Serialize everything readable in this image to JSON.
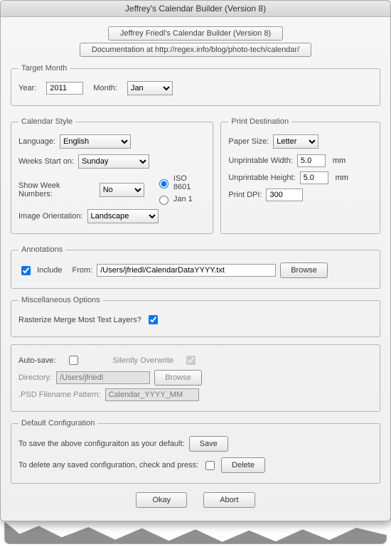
{
  "window": {
    "title": "Jeffrey's Calendar Builder (Version 8)"
  },
  "header": {
    "app_title": "Jeffrey Friedl's Calendar Builder (Version 8)",
    "doc_line": "Documentation at http://regex.info/blog/photo-tech/calendar/"
  },
  "target_month": {
    "legend": "Target Month",
    "year_label": "Year:",
    "year_value": "2011",
    "month_label": "Month:",
    "month_value": "Jan"
  },
  "calendar_style": {
    "legend": "Calendar Style",
    "language_label": "Language:",
    "language_value": "English",
    "weeks_start_label": "Weeks Start on:",
    "weeks_start_value": "Sunday",
    "show_week_label": "Show Week Numbers:",
    "show_week_value": "No",
    "radio_iso": "ISO 8601",
    "radio_jan1": "Jan 1",
    "orientation_label": "Image Orientation:",
    "orientation_value": "Landscape"
  },
  "print": {
    "legend": "Print Destination",
    "paper_label": "Paper Size:",
    "paper_value": "Letter",
    "uw_label": "Unprintable Width:",
    "uw_value": "5.0",
    "uh_label": "Unprintable Height:",
    "uh_value": "5.0",
    "unit": "mm",
    "dpi_label": "Print DPI:",
    "dpi_value": "300"
  },
  "annotations": {
    "legend": "Annotations",
    "include_label": "Include",
    "from_label": "From:",
    "path_value": "/Users/jfriedl/CalendarDataYYYY.txt",
    "browse": "Browse"
  },
  "misc": {
    "legend": "Miscellaneous Options",
    "rasterize_label": "Rasterize  Merge Most Text Layers?"
  },
  "autosave": {
    "autosave_label": "Auto-save:",
    "silent_label": "Silently Overwrite",
    "dir_label": "Directory:",
    "dir_value": "/Users/jfriedl",
    "browse": "Browse",
    "pattern_label": ".PSD Filename Pattern:",
    "pattern_value": "Calendar_YYYY_MM"
  },
  "defaults": {
    "legend": "Default Configuration",
    "save_line": "To save the above configuraiton as your default:",
    "save_btn": "Save",
    "delete_line": "To delete any saved configuration, check and press:",
    "delete_btn": "Delete"
  },
  "footer": {
    "ok": "Okay",
    "abort": "Abort"
  }
}
